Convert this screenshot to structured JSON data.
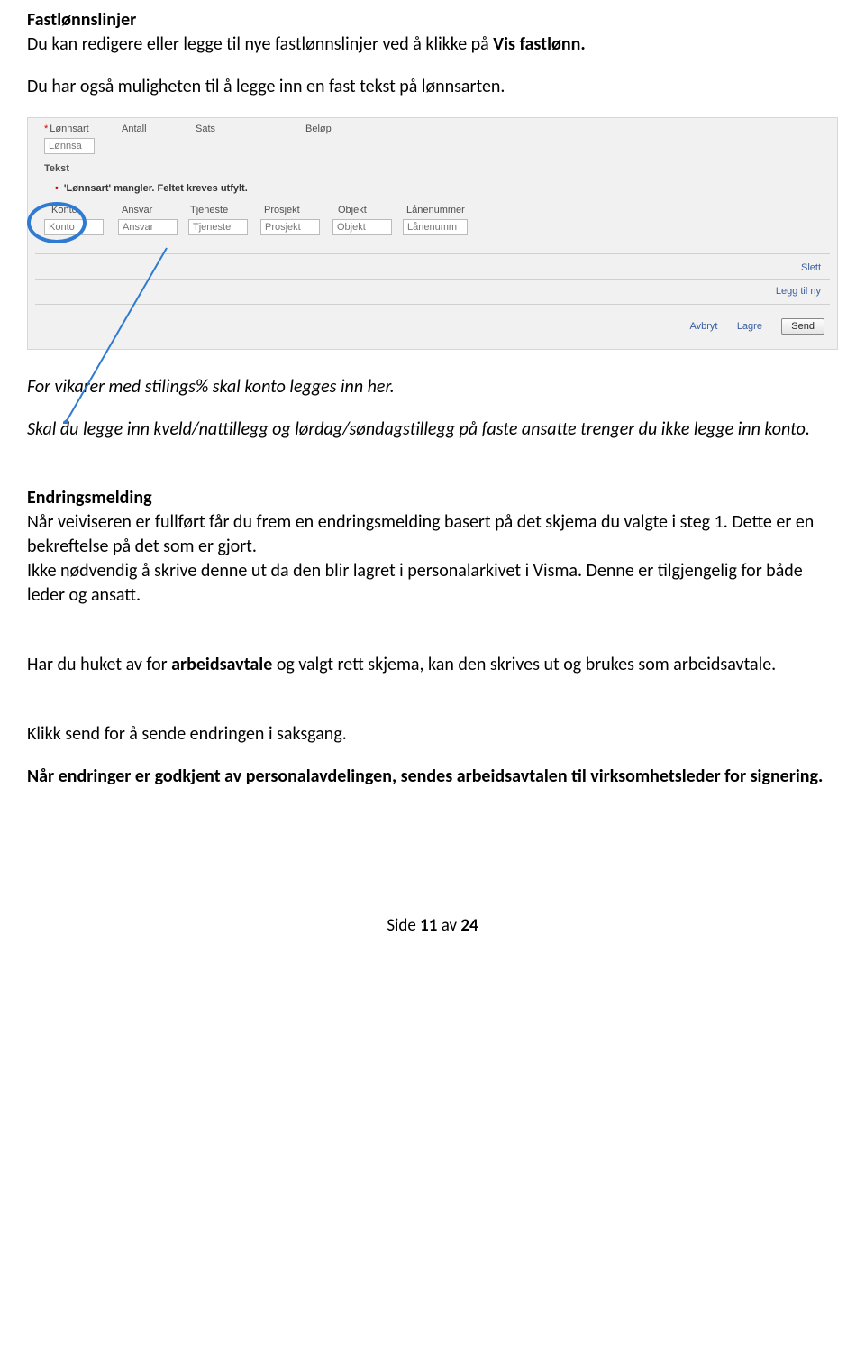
{
  "doc": {
    "h1": "Fastlønnslinjer",
    "p1a": "Du kan redigere eller legge til nye fastlønnslinjer ved å klikke på ",
    "p1b": "Vis fastlønn.",
    "p2": "Du har også muligheten til å legge inn en fast tekst på lønnsarten.",
    "p3": "For vikarer med stilings% skal konto legges inn her.",
    "p4": "Skal du legge inn kveld/nattillegg og lørdag/søndagstillegg på faste ansatte trenger du ikke legge inn konto.",
    "h2": "Endringsmelding",
    "p5": "Når veiviseren er fullført får du frem en endringsmelding basert på det skjema du valgte i steg 1. Dette er en bekreftelse på det som er gjort.",
    "p6": "Ikke nødvendig å skrive denne ut da den blir lagret i personalarkivet i Visma. Denne er tilgjengelig for både leder og ansatt.",
    "p7a": "Har du huket av for ",
    "p7b": "arbeidsavtale",
    "p7c": " og valgt rett skjema, kan den skrives ut og brukes som arbeidsavtale.",
    "p8": "Klikk send for å sende endringen i saksgang.",
    "p9": "Når endringer er godkjent av personalavdelingen, sendes arbeidsavtalen til virksomhetsleder for signering.",
    "footer_a": "Side ",
    "footer_b": "11",
    "footer_c": " av ",
    "footer_d": "24"
  },
  "form": {
    "labels": {
      "lonnsart": "Lønnsart",
      "antall": "Antall",
      "sats": "Sats",
      "belop": "Beløp",
      "tekst": "Tekst",
      "konto": "Konto",
      "ansvar": "Ansvar",
      "tjeneste": "Tjeneste",
      "prosjekt": "Prosjekt",
      "objekt": "Objekt",
      "lanenummer": "Lånenummer"
    },
    "placeholders": {
      "lonnsart": "Lønnsa",
      "konto": "Konto",
      "ansvar": "Ansvar",
      "tjeneste": "Tjeneste",
      "prosjekt": "Prosjekt",
      "objekt": "Objekt",
      "lanenummer": "Lånenumm"
    },
    "error": "'Lønnsart' mangler. Feltet kreves utfylt.",
    "links": {
      "slett": "Slett",
      "leggtil": "Legg til ny",
      "avbryt": "Avbryt",
      "lagre": "Lagre"
    },
    "buttons": {
      "send": "Send"
    },
    "req_mark": "*"
  }
}
